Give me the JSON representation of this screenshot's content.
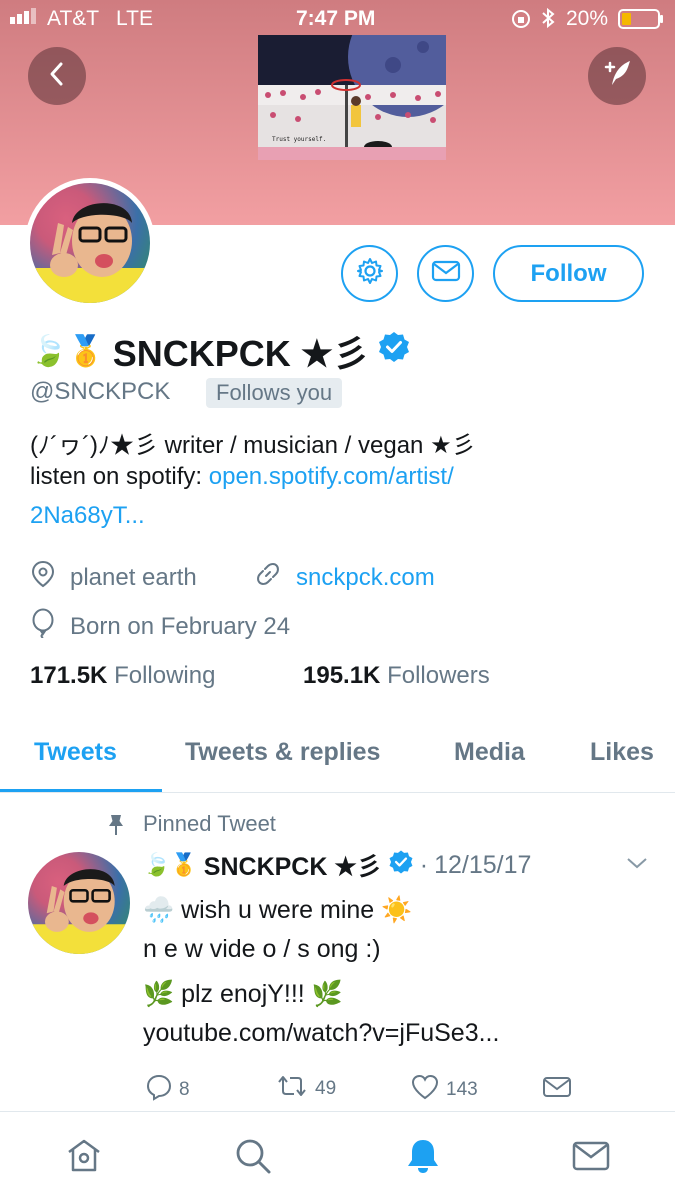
{
  "status_bar": {
    "carrier": "AT&T",
    "network": "LTE",
    "time": "7:47 PM",
    "battery_percent": "20%"
  },
  "banner": {
    "caption": "Trust yourself."
  },
  "profile": {
    "emojis": "🍃🥇",
    "name": "SNCKPCK ★彡",
    "handle": "@SNCKPCK",
    "follows_you": "Follows you",
    "follow_label": "Follow",
    "bio_line1": "(ﾉ´ヮ´)ﾉ★彡 writer / musician / vegan ★彡",
    "bio_line2_prefix": "listen on spotify: ",
    "bio_line2_link": "open.spotify.com/artist/",
    "bio_line3_link": "2Na68yT...",
    "location": "planet earth",
    "website": "snckpck.com",
    "birthday": "Born on February 24",
    "following_count": "171.5K",
    "following_label": "Following",
    "followers_count": "195.1K",
    "followers_label": "Followers"
  },
  "tabs": [
    {
      "label": "Tweets",
      "active": true
    },
    {
      "label": "Tweets & replies",
      "active": false
    },
    {
      "label": "Media",
      "active": false
    },
    {
      "label": "Likes",
      "active": false
    }
  ],
  "pinned_tweet": {
    "pinned_label": "Pinned Tweet",
    "author_emojis": "🍃🥇",
    "author_name": "SNCKPCK ★彡",
    "date": "12/15/17",
    "line1": "🌧️ wish u were mine ☀️",
    "line2": "n e w vide o / s ong :)",
    "line3": "🌿 plz enojY!!! 🌿",
    "link": "youtube.com/watch?v=jFuSe3...",
    "replies": "8",
    "retweets": "49",
    "likes": "143"
  },
  "colors": {
    "accent": "#1da1f2",
    "banner_top": "#cf7c80",
    "banner_bottom": "#f29fa2",
    "secondary_text": "#657786"
  },
  "icons": {
    "back": "back-arrow-icon",
    "compose": "compose-tweet-icon",
    "settings": "gear-icon",
    "message": "envelope-icon",
    "verified": "verified-badge-icon",
    "location": "location-pin-icon",
    "link": "link-icon",
    "birthday": "balloon-icon",
    "pin": "pin-icon",
    "home": "home-icon",
    "search": "search-icon",
    "notifications": "bell-icon",
    "messages": "envelope-icon"
  }
}
